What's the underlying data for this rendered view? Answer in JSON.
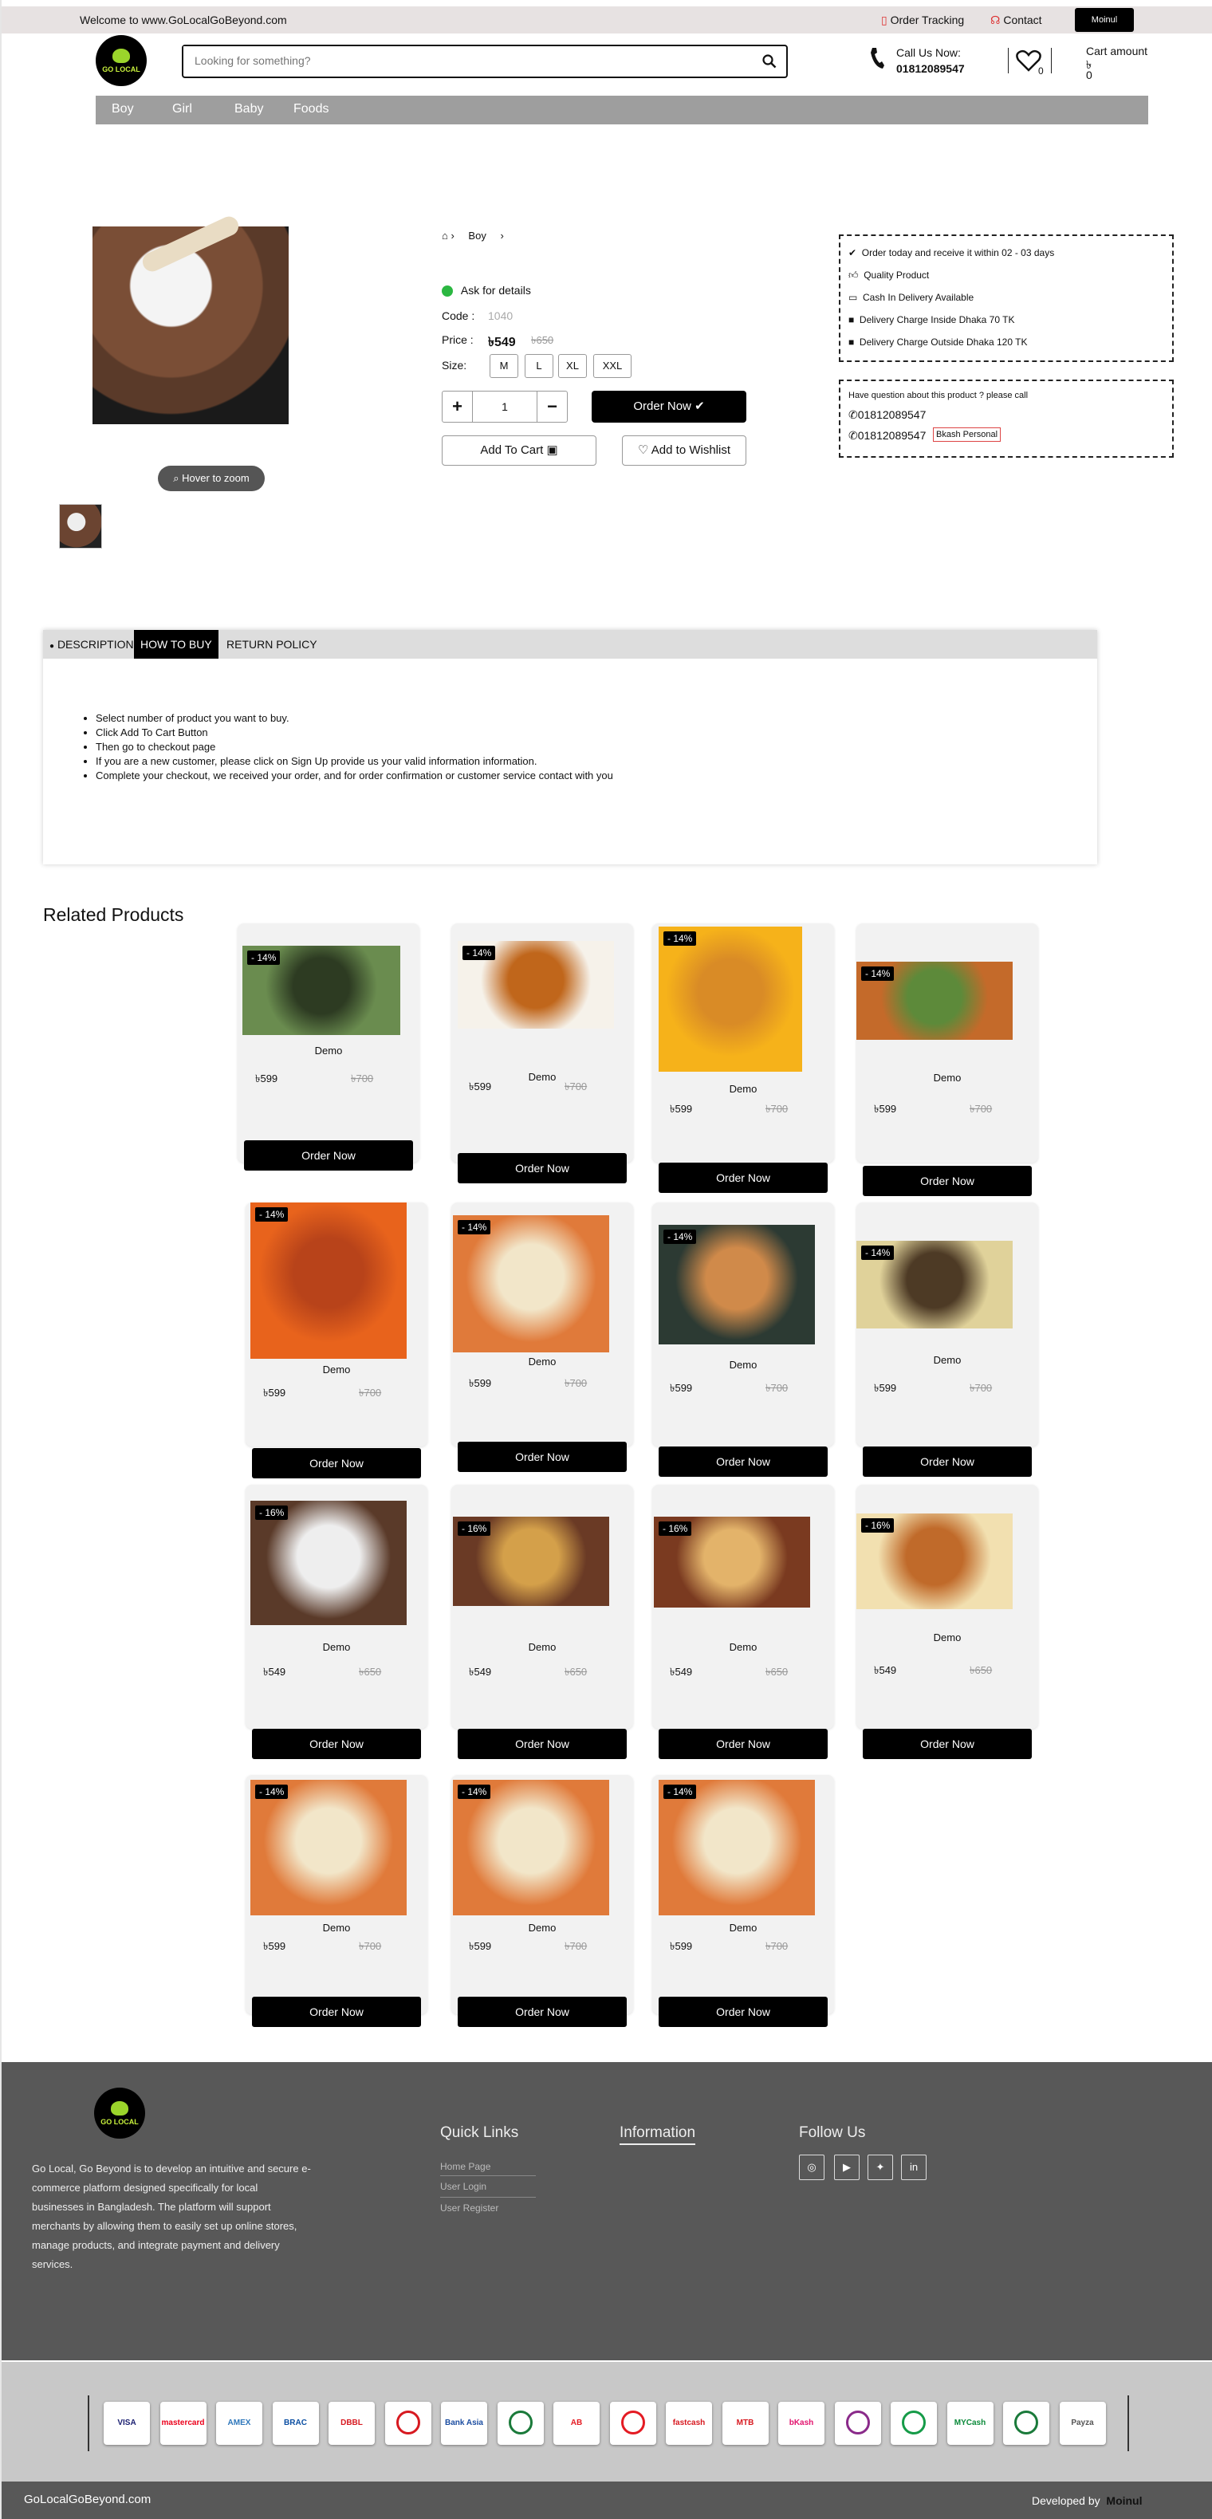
{
  "topbar": {
    "welcome": "Welcome to www.GoLocalGoBeyond.com",
    "order_tracking": "Order Tracking",
    "contact": "Contact",
    "user": "Moinul"
  },
  "logo": {
    "text": "GO LOCAL"
  },
  "search": {
    "placeholder": "Looking for something?"
  },
  "call": {
    "label": "Call Us Now:",
    "number": "01812089547"
  },
  "wishlist": {
    "count": "0"
  },
  "cart": {
    "label": "Cart amount",
    "currency": "৳",
    "amount": "0"
  },
  "nav": [
    "Boy",
    "Girl",
    "Baby",
    "Foods"
  ],
  "product": {
    "zoom_label": "Hover to zoom",
    "breadcrumb_item": "Boy",
    "ask_details": "Ask for details",
    "code_label": "Code :",
    "code": "1040",
    "price_label": "Price :",
    "price": "৳549",
    "old_price": "৳650",
    "size_label": "Size:",
    "sizes": [
      "M",
      "L",
      "XL",
      "XXL"
    ],
    "qty": "1",
    "order_now": "Order Now",
    "add_to_cart": "Add To Cart",
    "add_to_wishlist": "Add to Wishlist"
  },
  "delivery_info": [
    "Order today and receive it within 02 - 03 days",
    "Quality Product",
    "Cash In Delivery Available",
    "Delivery Charge Inside Dhaka 70 TK",
    "Delivery Charge Outside Dhaka 120 TK"
  ],
  "question": {
    "text": "Have question about this product ? please call",
    "phone1": "01812089547",
    "phone2": "01812089547",
    "bkash": "Bkash Personal"
  },
  "tabs": {
    "labels": [
      "DESCRIPTION",
      "HOW TO BUY",
      "RETURN POLICY"
    ],
    "active": 1,
    "steps": [
      "Select number of product you want to buy.",
      "Click Add To Cart Button",
      "Then go to checkout page",
      "If you are a new customer, please click on Sign Up provide us your valid information information.",
      "Complete your checkout, we received your order, and for order confirmation or customer service contact with you"
    ]
  },
  "related": {
    "title": "Related Products",
    "items": [
      {
        "badge": "- 14%",
        "name": "Demo",
        "price": "৳599",
        "old": "৳700",
        "btn": "Order Now"
      },
      {
        "badge": "- 14%",
        "name": "Demo",
        "price": "৳599",
        "old": "৳700",
        "btn": "Order Now"
      },
      {
        "badge": "- 14%",
        "name": "Demo",
        "price": "৳599",
        "old": "৳700",
        "btn": "Order Now"
      },
      {
        "badge": "- 14%",
        "name": "Demo",
        "price": "৳599",
        "old": "৳700",
        "btn": "Order Now"
      },
      {
        "badge": "- 14%",
        "name": "Demo",
        "price": "৳599",
        "old": "৳700",
        "btn": "Order Now"
      },
      {
        "badge": "- 14%",
        "name": "Demo",
        "price": "৳599",
        "old": "৳700",
        "btn": "Order Now"
      },
      {
        "badge": "- 14%",
        "name": "Demo",
        "price": "৳599",
        "old": "৳700",
        "btn": "Order Now"
      },
      {
        "badge": "- 14%",
        "name": "Demo",
        "price": "৳599",
        "old": "৳700",
        "btn": "Order Now"
      },
      {
        "badge": "- 16%",
        "name": "Demo",
        "price": "৳549",
        "old": "৳650",
        "btn": "Order Now"
      },
      {
        "badge": "- 16%",
        "name": "Demo",
        "price": "৳549",
        "old": "৳650",
        "btn": "Order Now"
      },
      {
        "badge": "- 16%",
        "name": "Demo",
        "price": "৳549",
        "old": "৳650",
        "btn": "Order Now"
      },
      {
        "badge": "- 16%",
        "name": "Demo",
        "price": "৳549",
        "old": "৳650",
        "btn": "Order Now"
      },
      {
        "badge": "- 14%",
        "name": "Demo",
        "price": "৳599",
        "old": "৳700",
        "btn": "Order Now"
      },
      {
        "badge": "- 14%",
        "name": "Demo",
        "price": "৳599",
        "old": "৳700",
        "btn": "Order Now"
      },
      {
        "badge": "- 14%",
        "name": "Demo",
        "price": "৳599",
        "old": "৳700",
        "btn": "Order Now"
      }
    ]
  },
  "footer": {
    "about": "Go Local, Go Beyond is to develop an intuitive and secure e-commerce platform designed specifically for local businesses in Bangladesh. The platform will support merchants by allowing them to easily set up online stores, manage products, and integrate payment and delivery services.",
    "quick_links_title": "Quick Links",
    "quick_links": [
      "Home Page",
      "User Login",
      "User Register"
    ],
    "information_title": "Information",
    "follow_title": "Follow Us",
    "socials": [
      "instagram-icon",
      "youtube-icon",
      "twitter-icon",
      "linkedin-icon"
    ]
  },
  "payments": [
    "VISA",
    "mastercard",
    "AMEX",
    "BRAC BANK",
    "DBBL NEXUS",
    "",
    "Bank Asia",
    "",
    "AB",
    "",
    "fastcash",
    "MTB",
    "bKash",
    "",
    "",
    "MYCash",
    "",
    "Payza"
  ],
  "bottom": {
    "site": "GoLocalGoBeyond.com",
    "developed_by": "Developed by",
    "developer": "Moinul"
  },
  "colors": {
    "nav_bg": "#9e9e9e",
    "footer_bg": "#585858",
    "accent": "#000000"
  }
}
